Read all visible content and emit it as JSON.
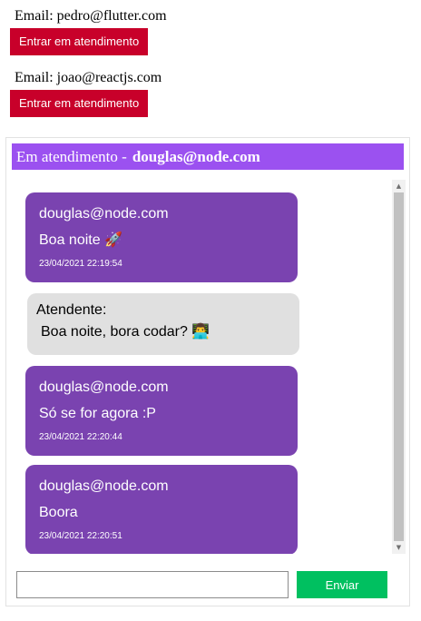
{
  "queue": [
    {
      "email_label": "Email: pedro@flutter.com",
      "button_label": "Entrar em atendimento"
    },
    {
      "email_label": "Email: joao@reactjs.com",
      "button_label": "Entrar em atendimento"
    }
  ],
  "chat": {
    "header_prefix": "Em atendimento -",
    "header_user": "douglas@node.com",
    "messages": [
      {
        "type": "user",
        "name": "douglas@node.com",
        "text": "Boa noite 🚀",
        "time": "23/04/2021 22:19:54"
      },
      {
        "type": "agent",
        "name": "Atendente:",
        "text": "Boa noite, bora codar? 👨‍💻"
      },
      {
        "type": "user",
        "name": "douglas@node.com",
        "text": "Só se for agora :P",
        "time": "23/04/2021 22:20:44"
      },
      {
        "type": "user",
        "name": "douglas@node.com",
        "text": "Boora",
        "time": "23/04/2021 22:20:51"
      }
    ],
    "input": {
      "value": "",
      "placeholder": ""
    },
    "send_label": "Enviar"
  }
}
